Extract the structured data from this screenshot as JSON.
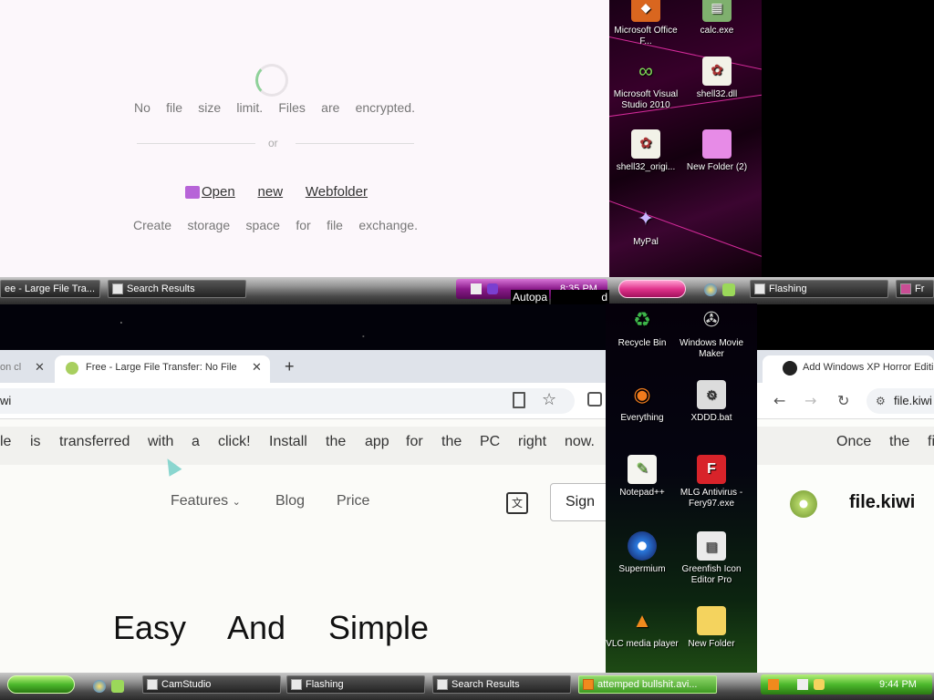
{
  "top_page": {
    "no_file_words": [
      "No",
      "file",
      "size",
      "limit.",
      "Files",
      "are",
      "encrypted."
    ],
    "divider_text": "or",
    "open_link_words": [
      "Open",
      "new",
      "Webfolder"
    ],
    "create_words": [
      "Create",
      "storage",
      "space",
      "for",
      "file",
      "exchange."
    ]
  },
  "desktop_top": {
    "icons": [
      {
        "label": "Microsoft Office F...",
        "icon": "office-icon"
      },
      {
        "label": "calc.exe",
        "icon": "calculator-icon"
      },
      {
        "label": "Microsoft Visual Studio 2010",
        "icon": "visual-studio-icon"
      },
      {
        "label": "shell32.dll",
        "icon": "dll-icon"
      },
      {
        "label": "shell32_origi...",
        "icon": "dll-icon"
      },
      {
        "label": "New Folder (2)",
        "icon": "folder-icon"
      },
      {
        "label": "MyPal",
        "icon": "mypal-icon"
      }
    ]
  },
  "desktop_mid": {
    "icons": [
      {
        "label": "Recycle Bin",
        "icon": "recycle-bin-icon"
      },
      {
        "label": "Windows Movie Maker",
        "icon": "movie-maker-icon"
      },
      {
        "label": "Everything",
        "icon": "everything-icon"
      },
      {
        "label": "XDDD.bat",
        "icon": "batch-file-icon"
      },
      {
        "label": "Notepad++",
        "icon": "notepad-plus-icon"
      },
      {
        "label": "MLG Antivirus - Fery97.exe",
        "icon": "antivirus-icon"
      },
      {
        "label": "Supermium",
        "icon": "supermium-icon"
      },
      {
        "label": "Greenfish Icon Editor Pro",
        "icon": "icon-editor-icon"
      },
      {
        "label": "VLC media player",
        "icon": "vlc-icon"
      },
      {
        "label": "New Folder",
        "icon": "folder-icon"
      }
    ]
  },
  "taskbar_top": {
    "buttons": [
      "ee - Large File Tra...",
      "Search Results"
    ],
    "clock": "8:35 PM",
    "tooltip": "Autopa",
    "tooltip_tail": "d"
  },
  "taskbar_right": {
    "buttons": [
      "Flashing",
      "Fr"
    ]
  },
  "taskbar_bottom": {
    "buttons": [
      "CamStudio",
      "Flashing",
      "Search Results",
      "attemped bullshit.avi..."
    ],
    "clock": "9:44 PM"
  },
  "browser": {
    "tabs": [
      {
        "label": "on cl"
      },
      {
        "label": "Free - Large File Transfer: No File"
      }
    ],
    "url": "wi",
    "banner_words": [
      "le",
      "is",
      "transferred",
      "with",
      "a",
      "click!",
      "Install",
      "the",
      "app",
      "for",
      "the",
      "PC",
      "right",
      "now."
    ],
    "nav": {
      "features": "Features",
      "blog": "Blog",
      "price": "Price",
      "sign": "Sign"
    },
    "hero_words": [
      "Easy",
      "And",
      "Simple"
    ]
  },
  "right_browser": {
    "tab_label": "Add Windows XP Horror Editi",
    "url": "file.kiwi",
    "banner_words": [
      "Once",
      "the",
      "fi"
    ],
    "brand": "file.kiwi"
  },
  "colors": {
    "accent_pink": "#d874d8",
    "banner_bg": "#f1f1ee"
  }
}
